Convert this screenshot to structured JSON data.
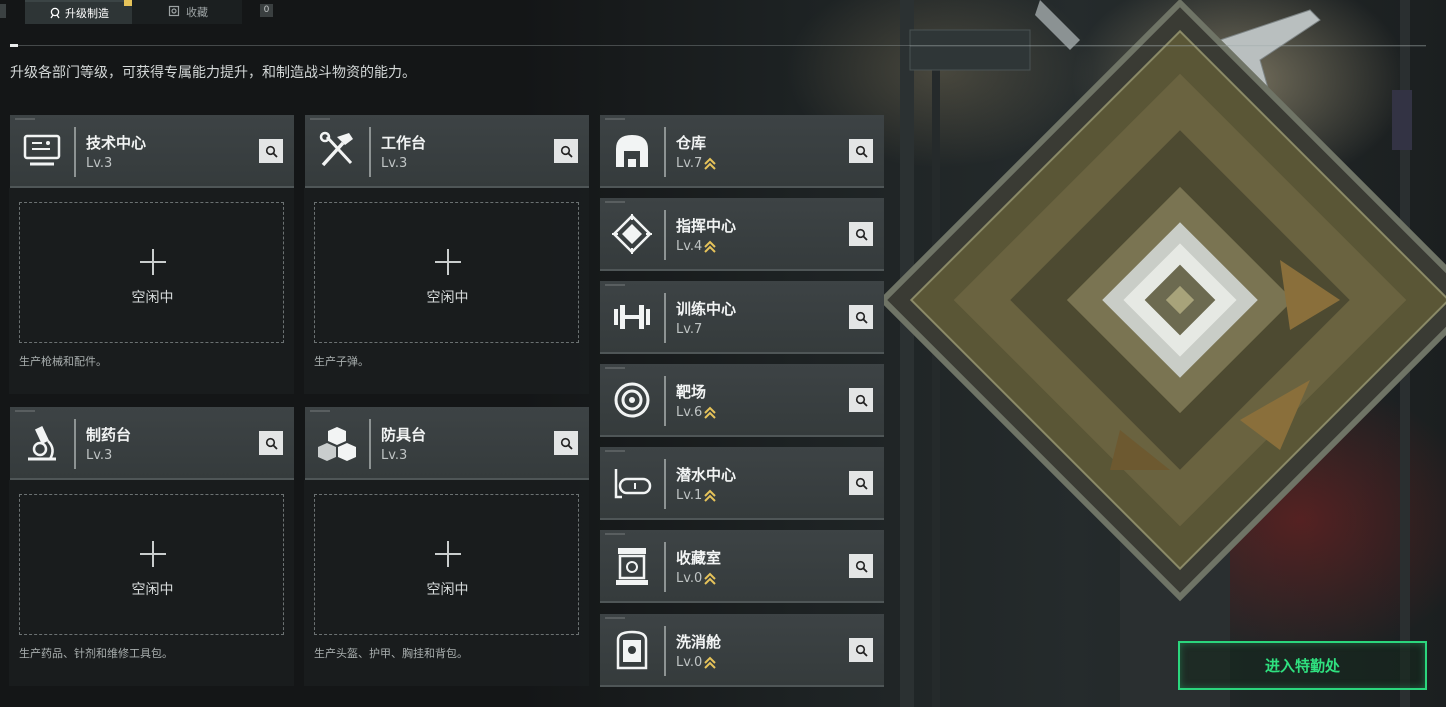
{
  "tabs": [
    {
      "label": "升级制造",
      "icon": "craft-icon",
      "active": true
    },
    {
      "label": "收藏",
      "icon": "collection-icon",
      "active": false
    }
  ],
  "tab_count": "0",
  "description": "升级各部门等级，可获得专属能力提升，和制造战斗物资的能力。",
  "workshops": [
    {
      "title": "技术中心",
      "level": "Lv.3",
      "icon": "computer-icon",
      "status": "空闲中",
      "desc": "生产枪械和配件。"
    },
    {
      "title": "工作台",
      "level": "Lv.3",
      "icon": "tools-icon",
      "status": "空闲中",
      "desc": "生产子弹。"
    },
    {
      "title": "制药台",
      "level": "Lv.3",
      "icon": "microscope-icon",
      "status": "空闲中",
      "desc": "生产药品、针剂和维修工具包。"
    },
    {
      "title": "防具台",
      "level": "Lv.3",
      "icon": "cubes-icon",
      "status": "空闲中",
      "desc": "生产头盔、护甲、胸挂和背包。"
    }
  ],
  "facilities": [
    {
      "title": "仓库",
      "level": "Lv.7",
      "icon": "warehouse-icon",
      "upgradable": true
    },
    {
      "title": "指挥中心",
      "level": "Lv.4",
      "icon": "chip-icon",
      "upgradable": true
    },
    {
      "title": "训练中心",
      "level": "Lv.7",
      "icon": "dumbbell-icon",
      "upgradable": false
    },
    {
      "title": "靶场",
      "level": "Lv.6",
      "icon": "target-icon",
      "upgradable": true
    },
    {
      "title": "潜水中心",
      "level": "Lv.1",
      "icon": "diving-mask-icon",
      "upgradable": true
    },
    {
      "title": "收藏室",
      "level": "Lv.0",
      "icon": "display-case-icon",
      "upgradable": true
    },
    {
      "title": "洗消舱",
      "level": "Lv.0",
      "icon": "decontamination-icon",
      "upgradable": true
    }
  ],
  "enter_button": "进入特勤处",
  "colors": {
    "accent_green": "#2bd67d",
    "upgrade_gold": "#e6c35a",
    "card_bg": "#3a4042"
  }
}
